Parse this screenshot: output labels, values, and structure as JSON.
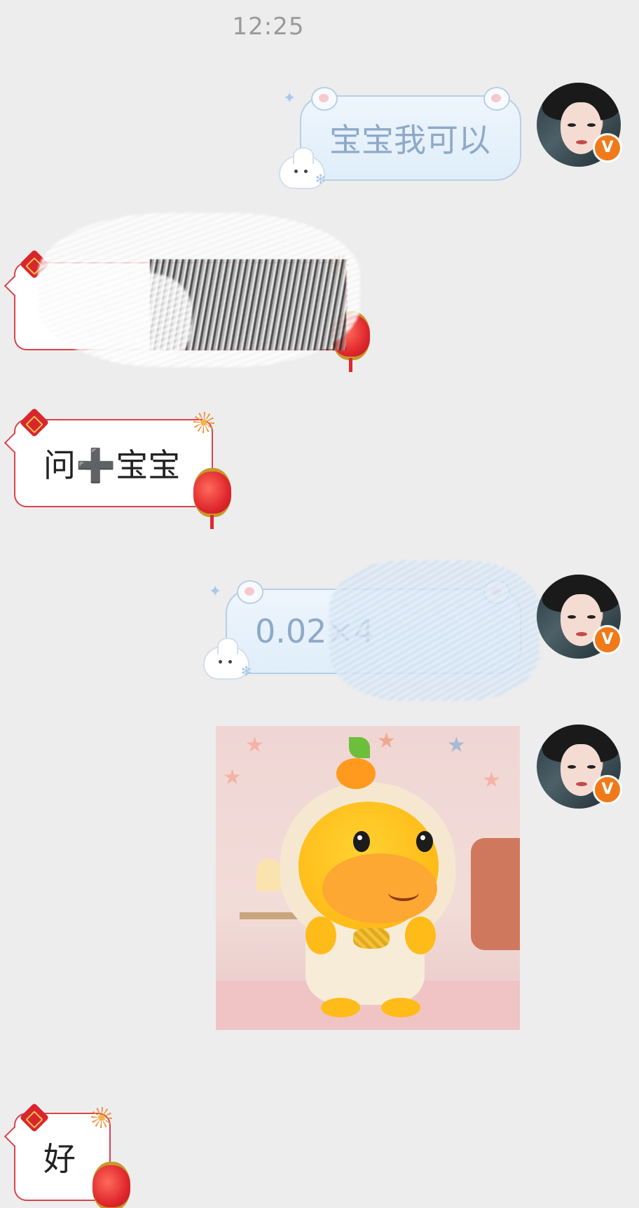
{
  "header": {
    "timestamp": "12:25"
  },
  "messages": [
    {
      "side": "right",
      "type": "text",
      "text": "宝宝我可以",
      "bubble_style": "cute-blue"
    },
    {
      "side": "left",
      "type": "text",
      "text": "",
      "bubble_style": "festive-red",
      "redacted": true
    },
    {
      "side": "left",
      "type": "text",
      "text": "问➕宝宝",
      "bubble_style": "festive-red"
    },
    {
      "side": "right",
      "type": "text",
      "text": "0.02×4",
      "bubble_style": "cute-blue",
      "partially_redacted": true
    },
    {
      "side": "right",
      "type": "sticker",
      "icon": "orange-hippo-plush-sticker"
    },
    {
      "side": "left",
      "type": "text",
      "text": "好",
      "bubble_style": "festive-red"
    }
  ],
  "avatar": {
    "badge_label": "V",
    "badge_color": "#f07a1a"
  },
  "colors": {
    "background": "#ededed",
    "blue_bubble_text": "#8fa9c8",
    "red_bubble_border": "#d9434b"
  }
}
